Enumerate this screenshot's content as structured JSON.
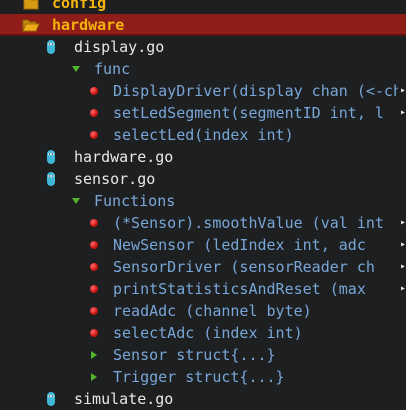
{
  "colors": {
    "background": "#1d1f20",
    "selected_row": "#8e1e17",
    "folder_text": "#f4b30f",
    "file_text": "#e8e8e8",
    "outline_text": "#79a6d8",
    "expander": "#52b52e",
    "method_dot": "#d01818",
    "go_file_icon": "#3fb7d6"
  },
  "tree": {
    "folders": [
      {
        "label": "config",
        "icon": "folder-icon"
      },
      {
        "label": "hardware",
        "icon": "folder-open-icon",
        "selected": true
      }
    ],
    "display_go": {
      "label": "display.go",
      "icon": "go-file-icon",
      "group": {
        "label": "func",
        "expanded": true,
        "members": [
          {
            "label": "DisplayDriver(display chan (<-chan",
            "icon": "method-dot-icon"
          },
          {
            "label": "setLedSegment(segmentID int, l",
            "icon": "method-dot-icon"
          },
          {
            "label": "selectLed(index int)",
            "icon": "method-dot-icon"
          }
        ]
      }
    },
    "hardware_go": {
      "label": "hardware.go",
      "icon": "go-file-icon"
    },
    "sensor_go": {
      "label": "sensor.go",
      "icon": "go-file-icon",
      "group": {
        "label": "Functions",
        "expanded": true,
        "members": [
          {
            "label": "(*Sensor).smoothValue (val int",
            "icon": "method-dot-icon"
          },
          {
            "label": "NewSensor (ledIndex int, adc",
            "icon": "method-dot-icon"
          },
          {
            "label": "SensorDriver (sensorReader ch",
            "icon": "method-dot-icon"
          },
          {
            "label": "printStatisticsAndReset (max",
            "icon": "method-dot-icon"
          },
          {
            "label": "readAdc (channel byte)",
            "icon": "method-dot-icon"
          },
          {
            "label": "selectAdc (index int)",
            "icon": "method-dot-icon"
          },
          {
            "label": "Sensor struct{...}",
            "icon": "collapsed-arrow-icon"
          },
          {
            "label": "Trigger struct{...}",
            "icon": "collapsed-arrow-icon"
          }
        ]
      }
    },
    "simulate_go": {
      "label": "simulate.go",
      "icon": "go-file-icon"
    },
    "overflow_indicator": "▸"
  }
}
